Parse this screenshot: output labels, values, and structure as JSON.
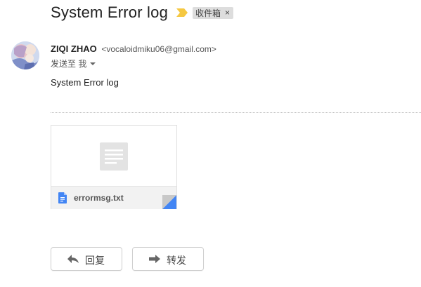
{
  "email": {
    "subject": "System Error log",
    "label": "收件箱",
    "label_remove": "×",
    "sender_name": "ZIQI ZHAO",
    "sender_email": "<vocaloidmiku06@gmail.com>",
    "to_text": "发送至 我",
    "body": "System Error log"
  },
  "attachment": {
    "filename": "errormsg.txt"
  },
  "actions": {
    "reply_label": "回复",
    "forward_label": "转发"
  },
  "colors": {
    "importance_marker": "#f5c842",
    "file_icon": "#4285f4",
    "label_chip": "#dddddd"
  },
  "icons": {
    "importance": "importance-marker-icon",
    "label_close": "close-icon",
    "to_caret": "chevron-down-icon",
    "preview": "document-icon",
    "file": "google-docs-icon",
    "reply": "reply-arrow-icon",
    "forward": "forward-arrow-icon"
  }
}
